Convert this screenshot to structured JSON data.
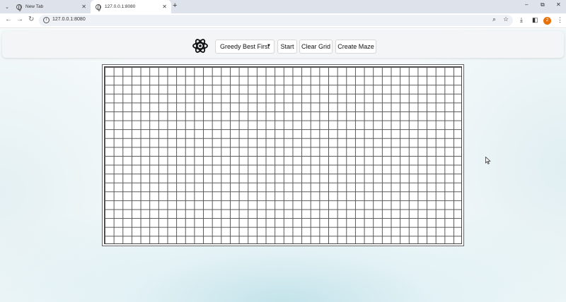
{
  "browser": {
    "tabs": [
      {
        "title": "New Tab",
        "active": false
      },
      {
        "title": "127.0.0.1:8080",
        "active": true
      }
    ],
    "new_tab_symbol": "+",
    "window_controls": [
      "–",
      "⧉",
      "✕"
    ],
    "url": "127.0.0.1:8080",
    "profile_badge": "2",
    "icons": [
      "back-icon",
      "forward-icon",
      "reload-icon",
      "site-info-icon",
      "zoom-icon",
      "bookmark-star-icon",
      "download-icon",
      "side-panel-icon",
      "menu-icon"
    ]
  },
  "app": {
    "logo_icon": "atom-logo-icon",
    "algorithm_select": {
      "selected": "Greedy Best First"
    },
    "buttons": {
      "start": "Start",
      "clear": "Clear Grid",
      "maze": "Create Maze"
    },
    "grid": {
      "columns": 40,
      "rows": 20
    }
  },
  "colors": {
    "tab_strip": "#dee3eb",
    "accent_badge": "#e8710a",
    "grid_line": "#555555"
  }
}
